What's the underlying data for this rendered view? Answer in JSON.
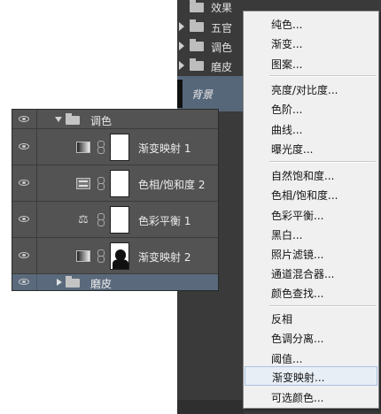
{
  "background_panel": {
    "header": "效果",
    "groups": [
      "五官",
      "调色",
      "磨皮"
    ],
    "bg_layer": "背景"
  },
  "layers_panel": {
    "group_name": "调色",
    "layers": [
      {
        "name": "渐变映射 1",
        "icon": "gradient-map-icon"
      },
      {
        "name": "色相/饱和度 2",
        "icon": "hue-saturation-icon"
      },
      {
        "name": "色彩平衡 1",
        "icon": "color-balance-icon"
      },
      {
        "name": "渐变映射 2",
        "icon": "gradient-map-icon"
      }
    ],
    "sub_group": "磨皮"
  },
  "menu": {
    "items": [
      "纯色...",
      "渐变...",
      "图案...",
      "亮度/对比度...",
      "色阶...",
      "曲线...",
      "曝光度...",
      "自然饱和度...",
      "色相/饱和度...",
      "色彩平衡...",
      "黑白...",
      "照片滤镜...",
      "通道混合器...",
      "颜色查找...",
      "反相",
      "色调分离...",
      "阈值...",
      "渐变映射...",
      "可选颜色..."
    ],
    "highlighted_index": 17
  }
}
